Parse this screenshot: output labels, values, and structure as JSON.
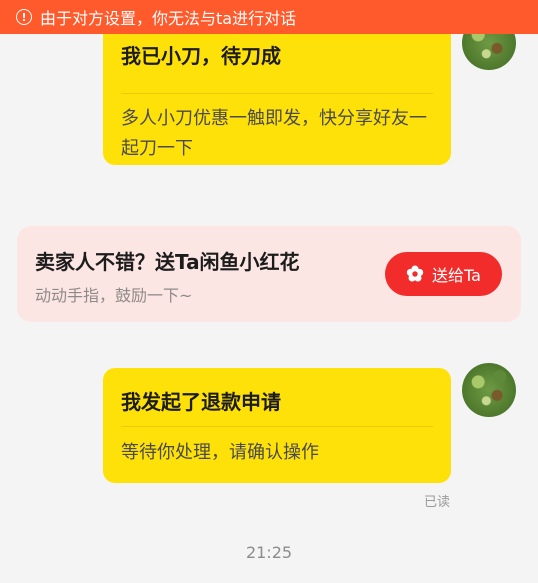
{
  "banner": {
    "icon": "exclamation-circle-icon",
    "text": "由于对方设置，你无法与ta进行对话",
    "color": "#FF5A2C"
  },
  "messages": [
    {
      "title": "我已小刀，待刀成",
      "description": "多人小刀优惠一触即发，快分享好友一起刀一下"
    },
    {
      "title": "我发起了退款申请",
      "description": "等待你处理，请确认操作"
    }
  ],
  "flower_card": {
    "title": "卖家人不错？送Ta闲鱼小红花",
    "subtitle": "动动手指，鼓励一下~",
    "button_label": "送给Ta",
    "button_icon": "flower-icon",
    "button_color": "#F22B2B"
  },
  "read_status": "已读",
  "timestamp": "21:25",
  "bubble_color": "#FFE10A"
}
